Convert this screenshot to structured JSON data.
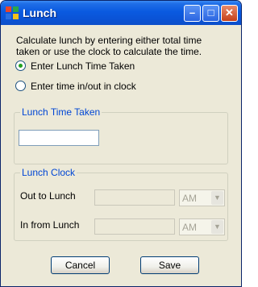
{
  "window": {
    "title": "Lunch",
    "minimize_glyph": "–",
    "maximize_glyph": "□",
    "close_glyph": "✕"
  },
  "description": "Calculate lunch by entering either total time taken or use the clock to calculate the time.",
  "options": [
    {
      "label": "Enter Lunch Time Taken",
      "selected": true
    },
    {
      "label": "Enter time in/out in clock",
      "selected": false
    }
  ],
  "time_taken_group": {
    "title": "Lunch Time Taken",
    "value": ""
  },
  "clock_group": {
    "title": "Lunch Clock",
    "out_label": "Out to Lunch",
    "out_value": "",
    "out_ampm": "AM",
    "in_label": "In from Lunch",
    "in_value": "",
    "in_ampm": "AM",
    "dropdown_glyph": "▼"
  },
  "buttons": {
    "cancel": "Cancel",
    "save": "Save"
  },
  "colors": {
    "titlebar": "#0a5ae0",
    "group_title": "#0046d5",
    "radio_dot": "#21a121",
    "background": "#ece9d8"
  }
}
